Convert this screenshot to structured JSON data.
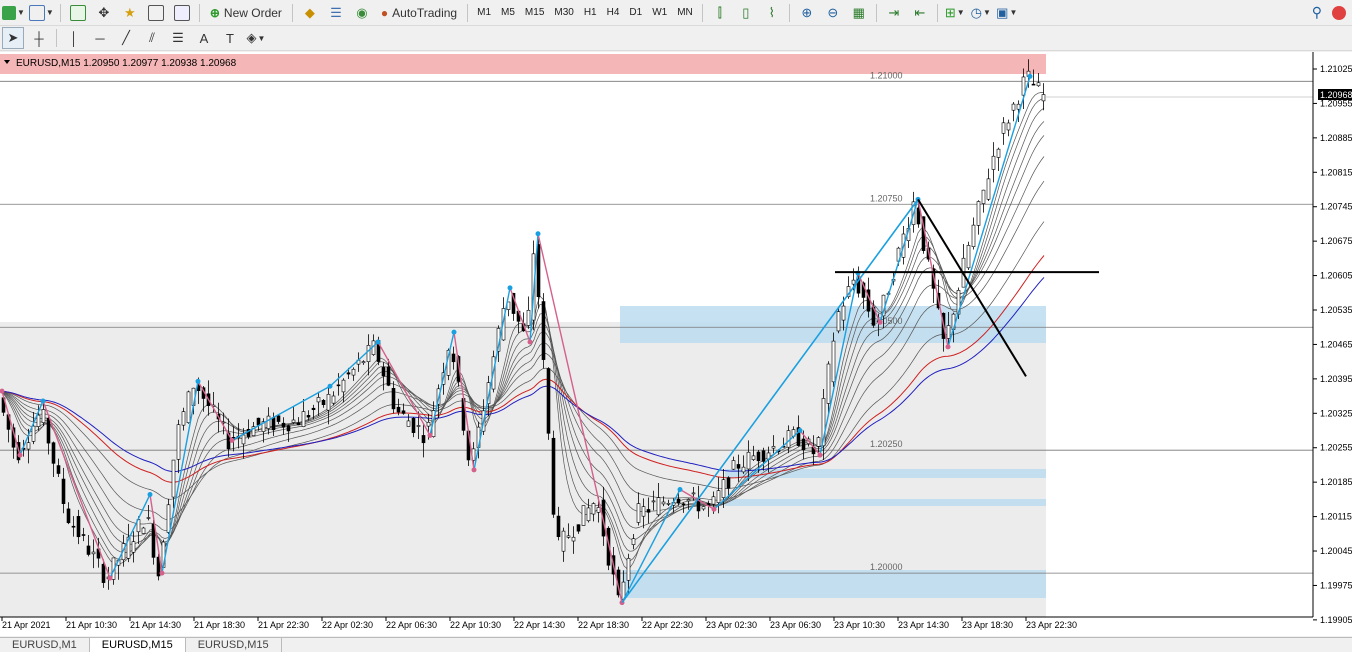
{
  "toolbar": {
    "new_order_label": "New Order",
    "autotrading_label": "AutoTrading",
    "timeframes": [
      "M1",
      "M5",
      "M15",
      "M30",
      "H1",
      "H4",
      "D1",
      "W1",
      "MN"
    ]
  },
  "chart": {
    "symbol_header": "EURUSD,M15  1.20950 1.20977 1.20938 1.20968",
    "current_price": "1.20968",
    "price_ticks": [
      "1.21025",
      "1.20955",
      "1.20885",
      "1.20815",
      "1.20745",
      "1.20675",
      "1.20605",
      "1.20535",
      "1.20465",
      "1.20395",
      "1.20325",
      "1.20255",
      "1.20185",
      "1.20115",
      "1.20045",
      "1.19975",
      "1.19905"
    ],
    "level_labels": [
      "1.21000",
      "1.20750",
      "1.20500",
      "1.20250",
      "1.20000"
    ],
    "time_ticks": [
      "21 Apr 2021",
      "21 Apr 10:30",
      "21 Apr 14:30",
      "21 Apr 18:30",
      "21 Apr 22:30",
      "22 Apr 02:30",
      "22 Apr 06:30",
      "22 Apr 10:30",
      "22 Apr 14:30",
      "22 Apr 18:30",
      "22 Apr 22:30",
      "23 Apr 02:30",
      "23 Apr 06:30",
      "23 Apr 10:30",
      "23 Apr 14:30",
      "23 Apr 18:30",
      "23 Apr 22:30"
    ],
    "colors": {
      "bull_zone": "#f4b6b6",
      "support_zone": "#bcdcef",
      "zigzag": "#1aa0e0",
      "zigzag_low": "#d4608c",
      "ema_blue": "#2020c0",
      "ema_red": "#d02020"
    }
  },
  "bottom_tabs": [
    "EURUSD,M1",
    "EURUSD,M15",
    "EURUSD,M15"
  ]
}
